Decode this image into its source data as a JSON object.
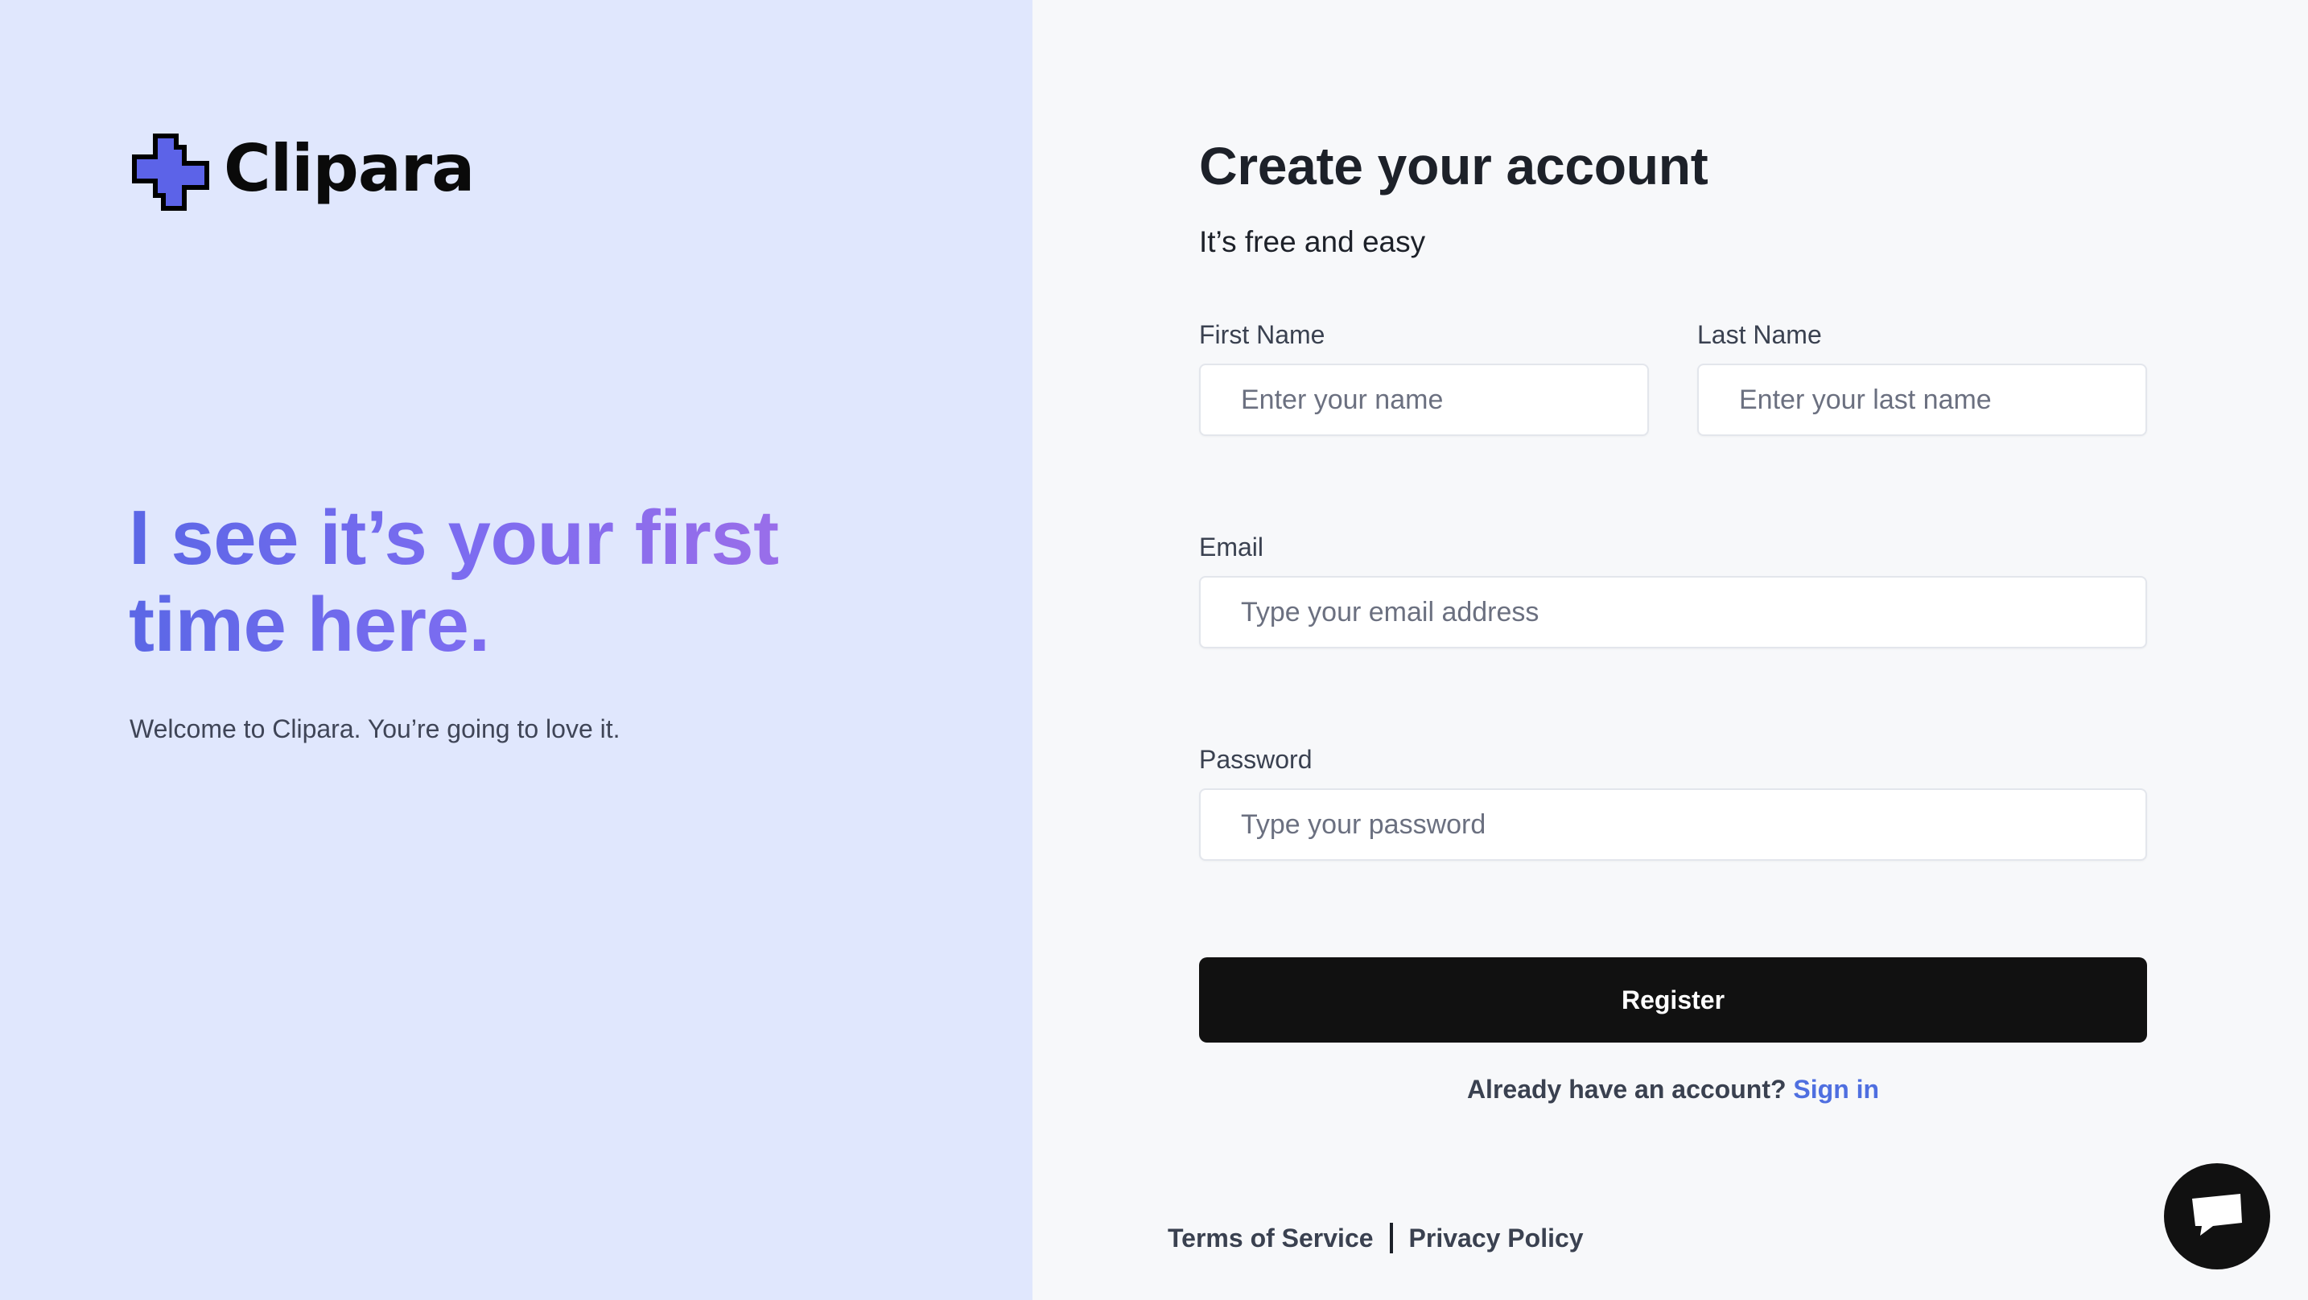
{
  "brand": {
    "name": "Clipara",
    "accent_color": "#5b67e6",
    "logo_icon": "plus-cross-logo-icon"
  },
  "hero": {
    "headline_line1": "I see it’s your first",
    "headline_line2": "time here.",
    "welcome_text": "Welcome to Clipara. You’re going to love it."
  },
  "form": {
    "title": "Create your account",
    "subtitle": "It’s free and easy",
    "first_name": {
      "label": "First Name",
      "placeholder": "Enter your name",
      "value": ""
    },
    "last_name": {
      "label": "Last Name",
      "placeholder": "Enter your last name",
      "value": ""
    },
    "email": {
      "label": "Email",
      "placeholder": "Type your email address",
      "value": ""
    },
    "password": {
      "label": "Password",
      "placeholder": "Type your password",
      "value": ""
    },
    "register_label": "Register",
    "signin_prompt": "Already have an account?",
    "signin_link": "Sign in"
  },
  "footer": {
    "terms": "Terms of Service",
    "privacy": "Privacy Policy"
  },
  "chat": {
    "icon": "chat-bubble-icon"
  }
}
